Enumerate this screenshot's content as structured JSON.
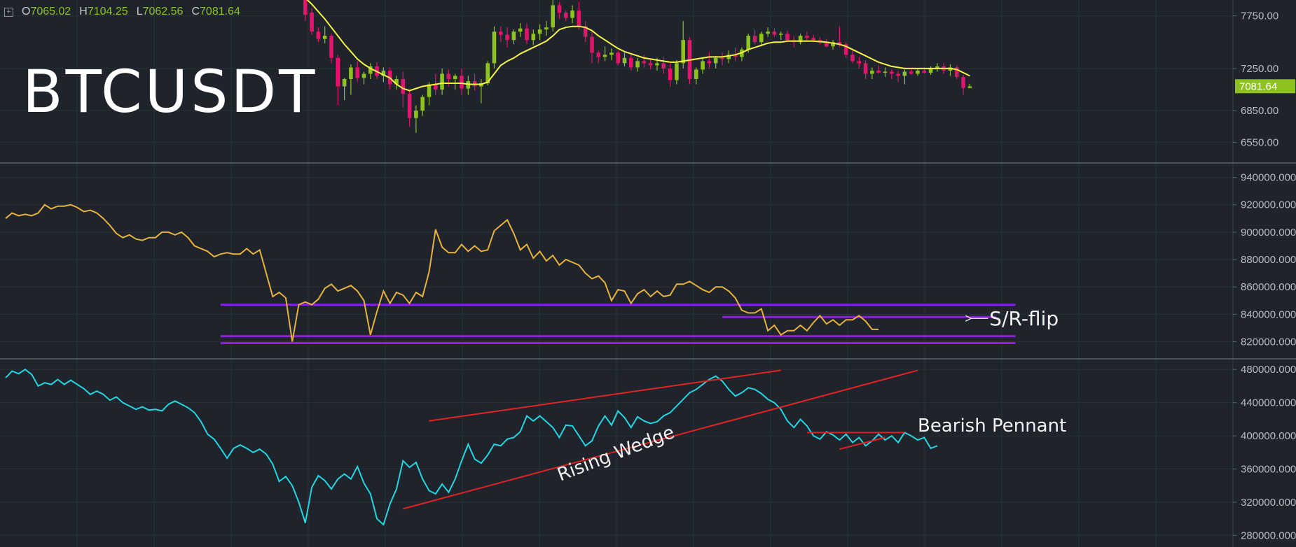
{
  "ohlc": {
    "expand_icon": "plus-square-icon",
    "items": [
      {
        "label": "O",
        "value": "7065.02"
      },
      {
        "label": "H",
        "value": "7104.25"
      },
      {
        "label": "L",
        "value": "7062.56"
      },
      {
        "label": "C",
        "value": "7081.64"
      }
    ]
  },
  "colors": {
    "background": "#1f242c",
    "up_candle": "#8dc21f",
    "down_candle": "#e0156b",
    "ma_line": "#f5f542",
    "panel2_line": "#e8b23a",
    "panel3_line": "#22d6e0",
    "support_lines": "#8a1fe0",
    "trend_lines": "#e52222",
    "price_tag": "#8dc21f"
  },
  "chart_data": [
    {
      "type": "candlestick",
      "title": "BTCUSDT",
      "ylim": [
        6360,
        7900
      ],
      "yticks": [
        "7750.00",
        "7250.00",
        "6850.00",
        "6550.00"
      ],
      "ytick_values": [
        7750,
        7250,
        6850,
        6550
      ],
      "last_price_label": "7081.64",
      "last_price_value": 7081.64,
      "n_slots": 150,
      "first_index": 46,
      "candles": [
        [
          7920,
          7960,
          7700,
          7760
        ],
        [
          7780,
          7820,
          7570,
          7600
        ],
        [
          7600,
          7640,
          7500,
          7530
        ],
        [
          7530,
          7650,
          7490,
          7560
        ],
        [
          7560,
          7580,
          7300,
          7350
        ],
        [
          7350,
          7380,
          6900,
          7080
        ],
        [
          7080,
          7160,
          6950,
          7150
        ],
        [
          7150,
          7290,
          7000,
          7260
        ],
        [
          7260,
          7320,
          7120,
          7160
        ],
        [
          7160,
          7220,
          7100,
          7200
        ],
        [
          7200,
          7300,
          7150,
          7270
        ],
        [
          7270,
          7310,
          7150,
          7180
        ],
        [
          7180,
          7260,
          7120,
          7230
        ],
        [
          7230,
          7260,
          7050,
          7100
        ],
        [
          7100,
          7180,
          7050,
          7150
        ],
        [
          7150,
          7220,
          6880,
          7010
        ],
        [
          7010,
          7050,
          6700,
          6780
        ],
        [
          6780,
          6900,
          6640,
          6850
        ],
        [
          6850,
          7000,
          6800,
          6980
        ],
        [
          6980,
          7120,
          6900,
          7100
        ],
        [
          7100,
          7200,
          7000,
          7050
        ],
        [
          7050,
          7250,
          7000,
          7200
        ],
        [
          7200,
          7240,
          7080,
          7150
        ],
        [
          7150,
          7200,
          7050,
          7180
        ],
        [
          7180,
          7250,
          7000,
          7060
        ],
        [
          7060,
          7180,
          7000,
          7130
        ],
        [
          7130,
          7200,
          7040,
          7080
        ],
        [
          7080,
          7150,
          6920,
          7110
        ],
        [
          7110,
          7320,
          7090,
          7300
        ],
        [
          7300,
          7650,
          7250,
          7600
        ],
        [
          7600,
          7650,
          7500,
          7570
        ],
        [
          7570,
          7640,
          7450,
          7520
        ],
        [
          7520,
          7620,
          7480,
          7600
        ],
        [
          7600,
          7680,
          7550,
          7630
        ],
        [
          7630,
          7680,
          7480,
          7520
        ],
        [
          7520,
          7620,
          7470,
          7580
        ],
        [
          7580,
          7670,
          7520,
          7620
        ],
        [
          7620,
          7700,
          7560,
          7640
        ],
        [
          7640,
          7900,
          7600,
          7850
        ],
        [
          7850,
          7880,
          7720,
          7780
        ],
        [
          7780,
          7800,
          7700,
          7730
        ],
        [
          7730,
          7850,
          7680,
          7800
        ],
        [
          7800,
          7880,
          7620,
          7650
        ],
        [
          7650,
          7700,
          7500,
          7550
        ],
        [
          7550,
          7600,
          7300,
          7400
        ],
        [
          7400,
          7420,
          7300,
          7360
        ],
        [
          7360,
          7460,
          7320,
          7380
        ],
        [
          7380,
          7440,
          7330,
          7400
        ],
        [
          7400,
          7420,
          7280,
          7300
        ],
        [
          7300,
          7400,
          7270,
          7350
        ],
        [
          7350,
          7380,
          7230,
          7260
        ],
        [
          7260,
          7350,
          7220,
          7320
        ],
        [
          7320,
          7380,
          7260,
          7300
        ],
        [
          7300,
          7350,
          7240,
          7280
        ],
        [
          7280,
          7350,
          7230,
          7300
        ],
        [
          7300,
          7360,
          7200,
          7250
        ],
        [
          7250,
          7300,
          7080,
          7140
        ],
        [
          7140,
          7330,
          7100,
          7300
        ],
        [
          7300,
          7700,
          7250,
          7520
        ],
        [
          7520,
          7550,
          7100,
          7150
        ],
        [
          7150,
          7260,
          7100,
          7240
        ],
        [
          7240,
          7350,
          7200,
          7320
        ],
        [
          7320,
          7400,
          7250,
          7300
        ],
        [
          7300,
          7370,
          7250,
          7350
        ],
        [
          7350,
          7400,
          7280,
          7340
        ],
        [
          7340,
          7420,
          7300,
          7380
        ],
        [
          7380,
          7450,
          7320,
          7360
        ],
        [
          7360,
          7450,
          7320,
          7430
        ],
        [
          7430,
          7580,
          7400,
          7560
        ],
        [
          7560,
          7620,
          7480,
          7500
        ],
        [
          7500,
          7600,
          7460,
          7580
        ],
        [
          7580,
          7640,
          7550,
          7600
        ],
        [
          7600,
          7630,
          7550,
          7570
        ],
        [
          7570,
          7600,
          7520,
          7580
        ],
        [
          7580,
          7610,
          7500,
          7520
        ],
        [
          7520,
          7560,
          7450,
          7500
        ],
        [
          7500,
          7580,
          7480,
          7560
        ],
        [
          7560,
          7600,
          7520,
          7540
        ],
        [
          7540,
          7570,
          7500,
          7520
        ],
        [
          7520,
          7550,
          7480,
          7500
        ],
        [
          7500,
          7530,
          7450,
          7460
        ],
        [
          7460,
          7520,
          7430,
          7500
        ],
        [
          7500,
          7650,
          7450,
          7480
        ],
        [
          7480,
          7500,
          7350,
          7380
        ],
        [
          7380,
          7420,
          7300,
          7320
        ],
        [
          7320,
          7360,
          7250,
          7300
        ],
        [
          7300,
          7330,
          7150,
          7200
        ],
        [
          7200,
          7260,
          7150,
          7230
        ],
        [
          7230,
          7280,
          7200,
          7210
        ],
        [
          7210,
          7260,
          7170,
          7220
        ],
        [
          7220,
          7240,
          7150,
          7200
        ],
        [
          7200,
          7230,
          7120,
          7180
        ],
        [
          7180,
          7240,
          7100,
          7220
        ],
        [
          7220,
          7260,
          7190,
          7200
        ],
        [
          7200,
          7250,
          7180,
          7230
        ],
        [
          7230,
          7260,
          7200,
          7210
        ],
        [
          7210,
          7270,
          7190,
          7250
        ],
        [
          7250,
          7300,
          7220,
          7270
        ],
        [
          7270,
          7300,
          7200,
          7230
        ],
        [
          7230,
          7290,
          7180,
          7260
        ],
        [
          7260,
          7280,
          7150,
          7170
        ],
        [
          7170,
          7190,
          7000,
          7065
        ],
        [
          7065,
          7104,
          7062,
          7081
        ]
      ],
      "ma": [
        7920,
        7860,
        7790,
        7720,
        7640,
        7560,
        7480,
        7410,
        7340,
        7290,
        7250,
        7220,
        7190,
        7160,
        7100,
        7060,
        7040,
        7060,
        7080,
        7090,
        7100,
        7110,
        7110,
        7110,
        7110,
        7100,
        7100,
        7100,
        7120,
        7200,
        7280,
        7320,
        7350,
        7390,
        7420,
        7450,
        7480,
        7510,
        7560,
        7620,
        7640,
        7650,
        7650,
        7640,
        7610,
        7560,
        7520,
        7480,
        7440,
        7410,
        7390,
        7370,
        7350,
        7340,
        7330,
        7320,
        7310,
        7310,
        7320,
        7330,
        7340,
        7350,
        7360,
        7360,
        7360,
        7370,
        7380,
        7400,
        7430,
        7450,
        7470,
        7490,
        7500,
        7500,
        7510,
        7510,
        7510,
        7510,
        7510,
        7505,
        7500,
        7490,
        7480,
        7460,
        7430,
        7400,
        7370,
        7340,
        7310,
        7290,
        7270,
        7260,
        7250,
        7250,
        7250,
        7250,
        7250,
        7250,
        7250,
        7250,
        7240,
        7210,
        7180
      ]
    },
    {
      "type": "line",
      "ylim": [
        808000,
        950000
      ],
      "yticks": [
        "940000.0000",
        "920000.0000",
        "900000.0000",
        "880000.0000",
        "860000.0000",
        "840000.0000",
        "820000.0000"
      ],
      "ytick_values": [
        940000,
        920000,
        900000,
        880000,
        860000,
        840000,
        820000
      ],
      "n_slots": 150,
      "values": [
        910000,
        914000,
        912000,
        913000,
        912000,
        914000,
        920000,
        917000,
        919000,
        919000,
        920000,
        918000,
        915000,
        916000,
        914000,
        910000,
        905000,
        899000,
        896000,
        898000,
        895000,
        894000,
        896000,
        896000,
        900000,
        900000,
        898000,
        900000,
        896000,
        890000,
        888000,
        886000,
        882000,
        884000,
        885000,
        884000,
        884000,
        888000,
        884000,
        887000,
        870000,
        853000,
        856000,
        852000,
        820000,
        847000,
        849000,
        847000,
        851000,
        859000,
        862000,
        857000,
        859000,
        861000,
        857000,
        850000,
        825000,
        842000,
        857000,
        848000,
        856000,
        854000,
        848000,
        856000,
        853000,
        871000,
        902000,
        889000,
        885000,
        885000,
        891000,
        886000,
        890000,
        886000,
        887000,
        901000,
        905000,
        909000,
        899000,
        887000,
        891000,
        881000,
        886000,
        879000,
        883000,
        876000,
        880000,
        878000,
        876000,
        870000,
        866000,
        868000,
        863000,
        850000,
        858000,
        857000,
        848000,
        855000,
        858000,
        853000,
        857000,
        853000,
        854000,
        862000,
        862000,
        864000,
        861000,
        858000,
        856000,
        860000,
        860000,
        857000,
        852000,
        843000,
        841000,
        841000,
        844000,
        828000,
        832000,
        825000,
        828000,
        828000,
        832000,
        828000,
        834000,
        839000,
        833000,
        836000,
        832000,
        836000,
        836000,
        839000,
        835000,
        829000,
        829000
      ],
      "hlines": [
        {
          "y": 847000,
          "from_index": 33,
          "to_index": 155
        },
        {
          "y": 838000,
          "from_index": 110,
          "to_index": 152
        },
        {
          "y": 824000,
          "from_index": 33,
          "to_index": 155
        },
        {
          "y": 819000,
          "from_index": 33,
          "to_index": 155
        }
      ],
      "annotations": [
        {
          "text": "S/R-flip",
          "icon": "arrow-left-icon",
          "x_index": 151,
          "y": 837000
        }
      ]
    },
    {
      "type": "line",
      "ylim": [
        266000,
        492000
      ],
      "yticks": [
        "480000.0000",
        "440000.0000",
        "400000.0000",
        "360000.0000",
        "320000.0000",
        "280000.0000"
      ],
      "ytick_values": [
        480000,
        440000,
        400000,
        360000,
        320000,
        280000
      ],
      "n_slots": 150,
      "values": [
        470000,
        478000,
        475000,
        480000,
        474000,
        460000,
        464000,
        462000,
        468000,
        462000,
        467000,
        462000,
        457000,
        450000,
        454000,
        450000,
        443000,
        447000,
        440000,
        436000,
        432000,
        435000,
        431000,
        432000,
        430000,
        438000,
        442000,
        438000,
        434000,
        428000,
        417000,
        402000,
        396000,
        385000,
        373000,
        385000,
        389000,
        385000,
        380000,
        384000,
        378000,
        366000,
        345000,
        351000,
        340000,
        320000,
        295000,
        338000,
        352000,
        346000,
        336000,
        348000,
        354000,
        348000,
        363000,
        343000,
        330000,
        300000,
        293000,
        318000,
        336000,
        370000,
        362000,
        368000,
        348000,
        334000,
        330000,
        342000,
        332000,
        348000,
        370000,
        390000,
        372000,
        367000,
        377000,
        390000,
        388000,
        396000,
        398000,
        405000,
        424000,
        418000,
        424000,
        417000,
        410000,
        398000,
        413000,
        412000,
        400000,
        388000,
        394000,
        412000,
        424000,
        413000,
        430000,
        422000,
        410000,
        423000,
        418000,
        415000,
        417000,
        424000,
        428000,
        436000,
        444000,
        452000,
        456000,
        462000,
        468000,
        472000,
        466000,
        456000,
        448000,
        452000,
        458000,
        456000,
        451000,
        444000,
        440000,
        432000,
        418000,
        410000,
        420000,
        412000,
        400000,
        396000,
        405000,
        401000,
        395000,
        402000,
        392000,
        398000,
        388000,
        394000,
        402000,
        395000,
        400000,
        392000,
        404000,
        400000,
        395000,
        398000,
        385000,
        388000
      ],
      "trend_lines": [
        {
          "from": [
            65,
            418000
          ],
          "to": [
            119,
            479000
          ]
        },
        {
          "from": [
            61,
            312000
          ],
          "to": [
            140,
            479000
          ]
        },
        {
          "from": [
            123,
            404000
          ],
          "to": [
            138,
            404000
          ]
        },
        {
          "from": [
            128,
            384000
          ],
          "to": [
            135,
            398000
          ]
        }
      ],
      "annotations": [
        {
          "text": "Rising Wedge",
          "x_index": 94,
          "y": 372000,
          "rotate": -21
        },
        {
          "text": "Bearish Pennant",
          "x_index": 140,
          "y": 405000
        }
      ]
    }
  ]
}
